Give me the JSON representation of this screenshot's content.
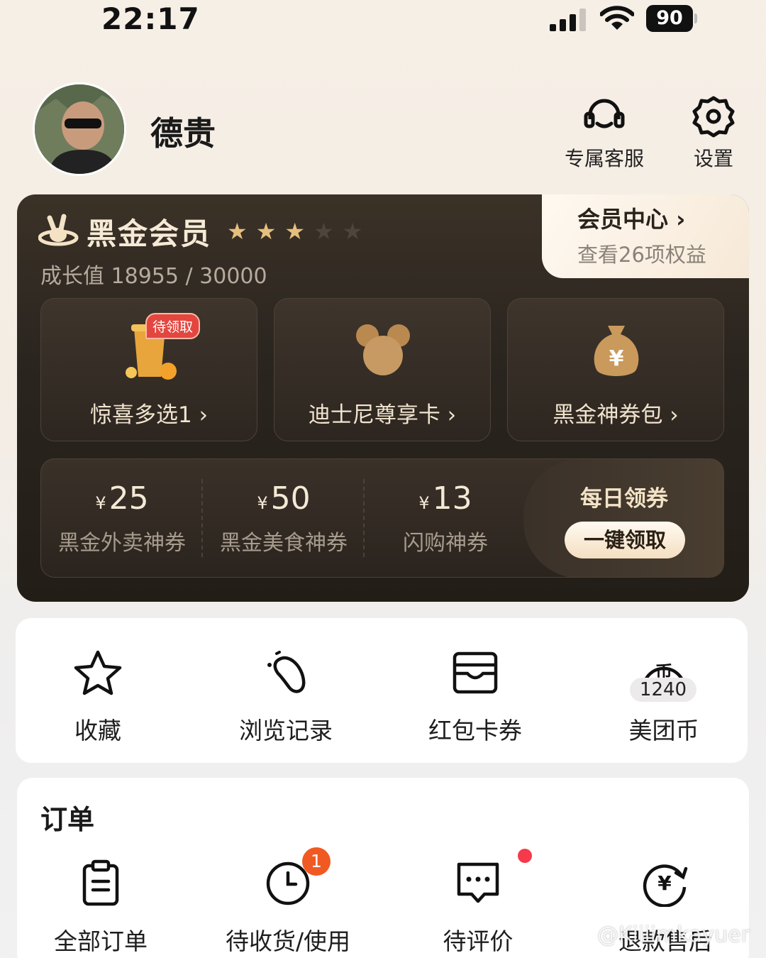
{
  "status_bar": {
    "time": "22:17",
    "battery": "90"
  },
  "profile": {
    "name": "德贵"
  },
  "top_actions": {
    "service_label": "专属客服",
    "settings_label": "设置"
  },
  "member": {
    "title": "黑金会员",
    "stars_filled": 3,
    "stars_total": 5,
    "growth": "成长值 18955 / 30000",
    "center_title": "会员中心",
    "center_sub": "查看26项权益",
    "perks": [
      {
        "label": "惊喜多选1",
        "badge": "待领取"
      },
      {
        "label": "迪士尼尊享卡"
      },
      {
        "label": "黑金神券包"
      }
    ],
    "coupons": [
      {
        "currency": "¥",
        "amount": "25",
        "label": "黑金外卖神券"
      },
      {
        "currency": "¥",
        "amount": "50",
        "label": "黑金美食神券"
      },
      {
        "currency": "¥",
        "amount": "13",
        "label": "闪购神券"
      }
    ],
    "daily_title": "每日领券",
    "claim_button": "一键领取"
  },
  "quick": {
    "items": [
      {
        "label": "收藏"
      },
      {
        "label": "浏览记录"
      },
      {
        "label": "红包卡券"
      },
      {
        "label": "美团币",
        "count": "1240",
        "coin_glyph": "币"
      }
    ]
  },
  "orders": {
    "title": "订单",
    "items": [
      {
        "label": "全部订单"
      },
      {
        "label": "待收货/使用",
        "badge": "1"
      },
      {
        "label": "待评价"
      },
      {
        "label": "退款售后"
      }
    ]
  },
  "watermark": "@Kiiiimkayuer",
  "colors": {
    "accent_gold": "#e6bf7e",
    "badge_orange": "#f05a22",
    "card_dark": "#2b2520"
  }
}
